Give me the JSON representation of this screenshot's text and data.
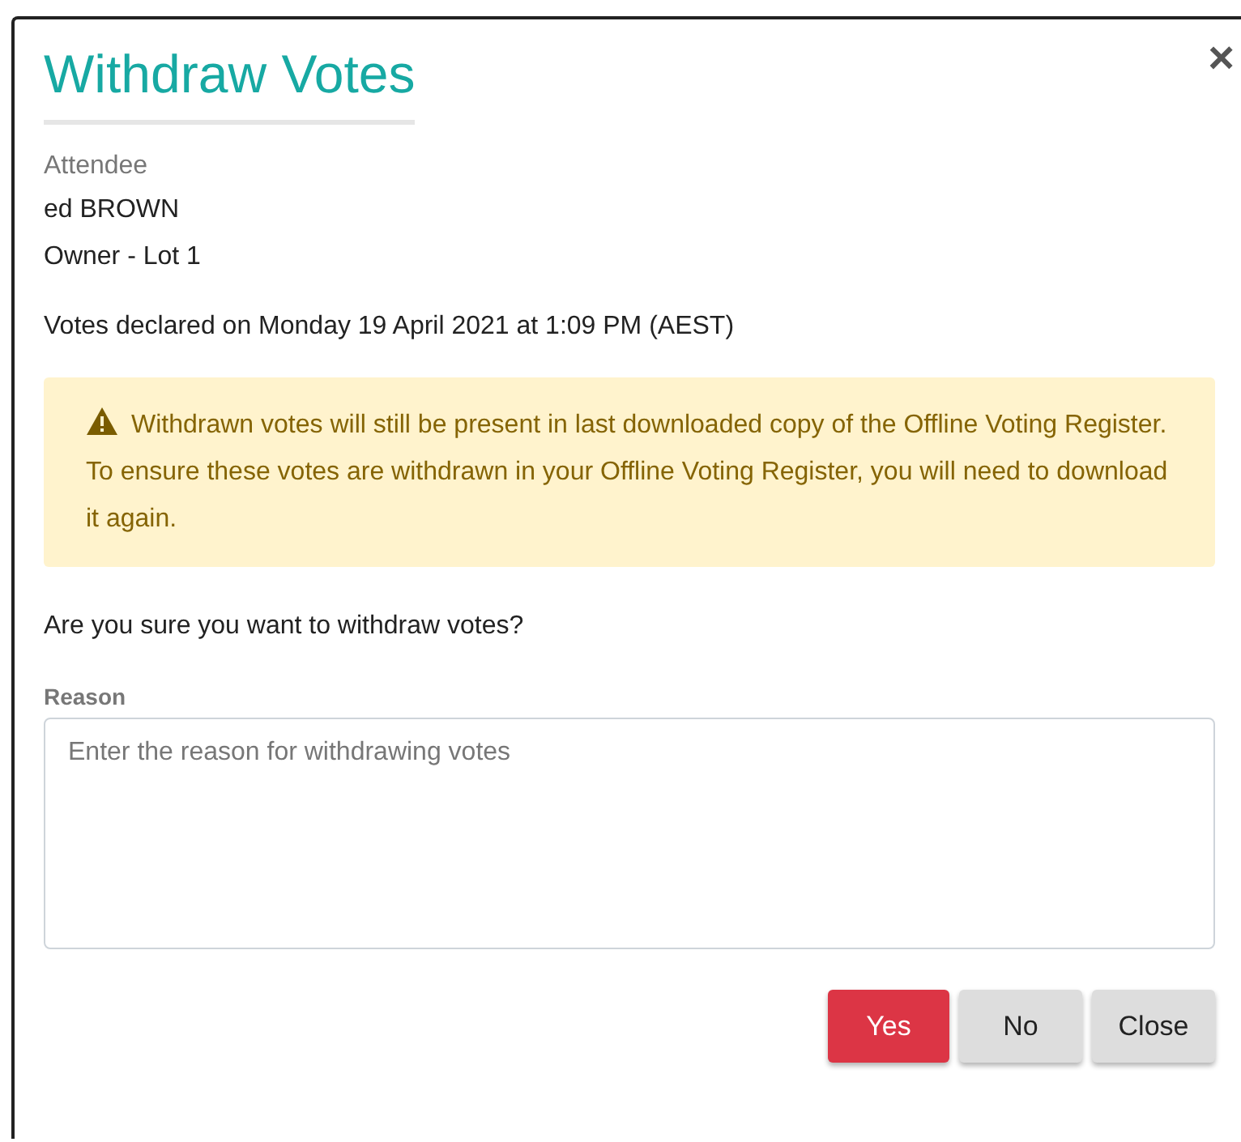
{
  "dialog": {
    "title": "Withdraw Votes",
    "close_icon": "×",
    "attendee_label": "Attendee",
    "attendee_name": "ed BROWN",
    "attendee_role": "Owner - Lot 1",
    "declared": "Votes declared on Monday 19 April 2021 at 1:09 PM (AEST)",
    "warning": "Withdrawn votes will still be present in last downloaded copy of the Offline Voting Register. To ensure these votes are withdrawn in your Offline Voting Register, you will need to download it again.",
    "question": "Are you sure you want to withdraw votes?",
    "reason": {
      "label": "Reason",
      "placeholder": "Enter the reason for withdrawing votes"
    },
    "buttons": [
      {
        "label": "Yes",
        "kind": "danger"
      },
      {
        "label": "No",
        "kind": "default"
      },
      {
        "label": "Close",
        "kind": "default"
      }
    ]
  }
}
